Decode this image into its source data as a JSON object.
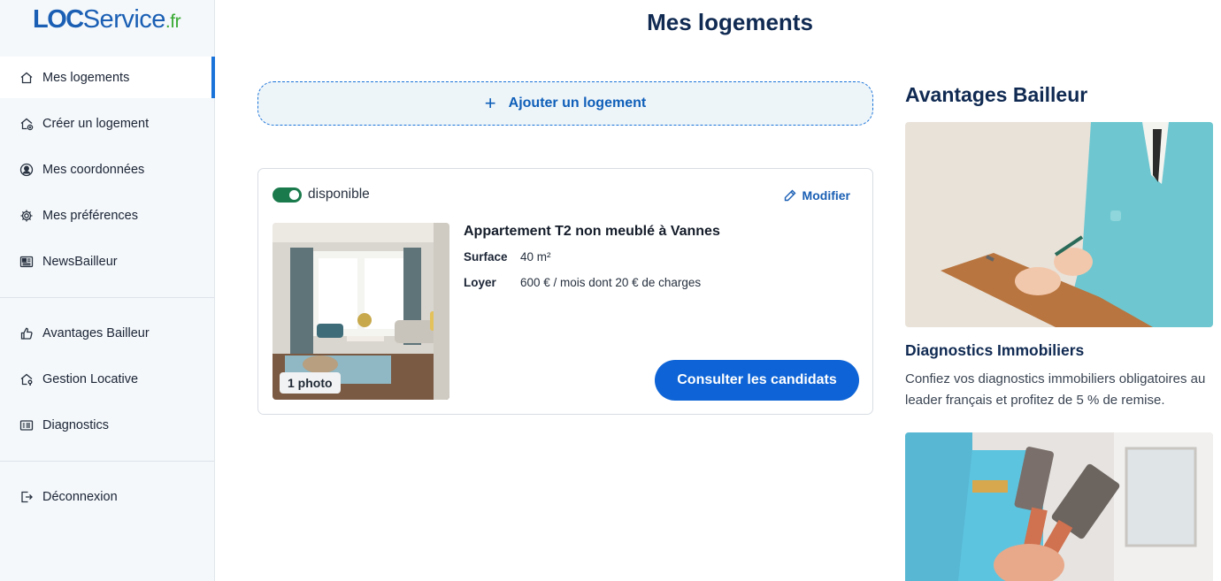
{
  "brand": {
    "loc": "LOC",
    "service": "Service",
    "tld": ".fr"
  },
  "sidebar": {
    "items": [
      {
        "label": "Mes logements",
        "icon": "home-icon"
      },
      {
        "label": "Créer un logement",
        "icon": "home-add-icon"
      },
      {
        "label": "Mes coordonnées",
        "icon": "user-circle-icon"
      },
      {
        "label": "Mes préférences",
        "icon": "gear-icon"
      },
      {
        "label": "NewsBailleur",
        "icon": "newspaper-icon"
      }
    ],
    "secondary": [
      {
        "label": "Avantages Bailleur",
        "icon": "thumbs-up-icon"
      },
      {
        "label": "Gestion Locative",
        "icon": "home-key-icon"
      },
      {
        "label": "Diagnostics",
        "icon": "id-card-icon"
      }
    ],
    "logout": {
      "label": "Déconnexion",
      "icon": "logout-icon"
    }
  },
  "main": {
    "title": "Mes logements",
    "add_label": "Ajouter un logement",
    "listing": {
      "status": "disponible",
      "modify_label": "Modifier",
      "title": "Appartement T2 non meublé à Vannes",
      "surface_label": "Surface",
      "surface_value": "40 m²",
      "rent_label": "Loyer",
      "rent_value": "600 € / mois dont 20 € de charges",
      "photo_count": "1 photo",
      "cta_label": "Consulter les candidats"
    }
  },
  "aside": {
    "title": "Avantages Bailleur",
    "card": {
      "title": "Diagnostics Immobiliers",
      "text": "Confiez vos diagnostics immobiliers obligatoires au leader français et profitez de 5 % de remise."
    }
  },
  "colors": {
    "accent": "#0e64d6",
    "brand": "#1a5fb4",
    "brand_green": "#3aaa35",
    "toggle_on": "#1a7a4c",
    "heading": "#102a52"
  }
}
